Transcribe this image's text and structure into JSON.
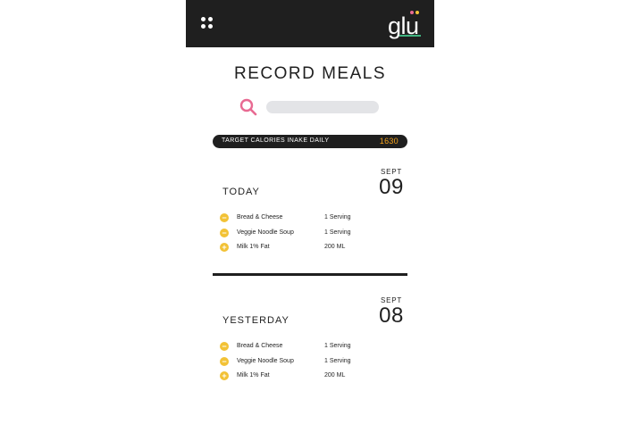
{
  "colors": {
    "dark": "#1f1f1f",
    "accent_yellow": "#f2c236",
    "accent_pink": "#e86a92",
    "accent_orange": "#f4a21c",
    "logo_green": "#3fb27f",
    "search_field": "#e3e4e7"
  },
  "header": {
    "menu_icon": "grid-dots-icon",
    "logo_text": "glu"
  },
  "page_title": "RECORD MEALS",
  "search": {
    "icon": "search-icon",
    "value": "",
    "placeholder": ""
  },
  "target": {
    "label": "TARGET CALORIES INAKE DAILY",
    "value": "1630"
  },
  "days": [
    {
      "label": "TODAY",
      "month": "SEPT",
      "date": "09",
      "items": [
        {
          "icon": "minus-circle-icon",
          "symbol": "−",
          "name": "Bread & Cheese",
          "qty": "1 Serving"
        },
        {
          "icon": "minus-circle-icon",
          "symbol": "−",
          "name": "Veggie Noodle Soup",
          "qty": "1 Serving"
        },
        {
          "icon": "plus-circle-icon",
          "symbol": "+",
          "name": "Milk 1% Fat",
          "qty": "200 ML"
        }
      ]
    },
    {
      "label": "YESTERDAY",
      "month": "SEPT",
      "date": "08",
      "items": [
        {
          "icon": "minus-circle-icon",
          "symbol": "−",
          "name": "Bread & Cheese",
          "qty": "1 Serving"
        },
        {
          "icon": "minus-circle-icon",
          "symbol": "−",
          "name": "Veggie Noodle Soup",
          "qty": "1 Serving"
        },
        {
          "icon": "plus-circle-icon",
          "symbol": "+",
          "name": "Milk 1% Fat",
          "qty": "200 ML"
        }
      ]
    }
  ]
}
